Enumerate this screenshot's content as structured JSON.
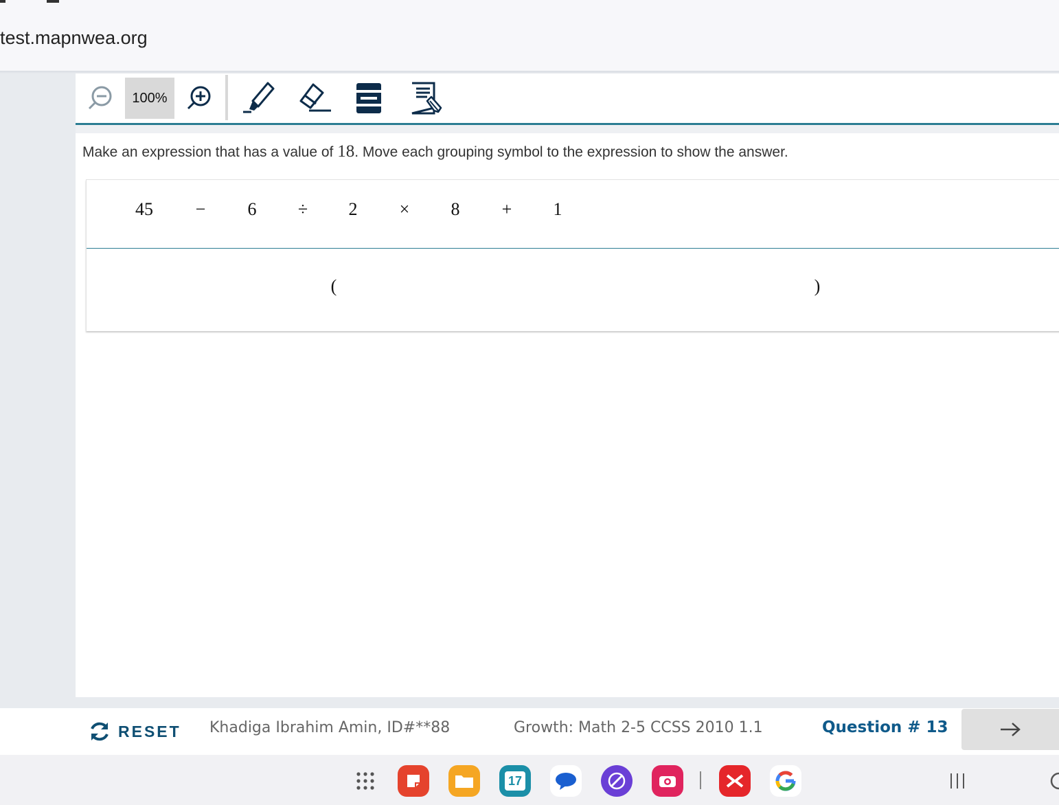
{
  "browser": {
    "url": "test.mapnwea.org"
  },
  "toolbar": {
    "zoom_level": "100%",
    "tools": [
      "zoom-out",
      "zoom-in",
      "highlighter",
      "eraser",
      "line-reader",
      "notepad"
    ]
  },
  "question": {
    "prompt_before": "Make an expression that has a value of ",
    "target_value": "18",
    "prompt_after": ". Move each grouping symbol to the expression to show the answer.",
    "expression": [
      "45",
      "−",
      "6",
      "÷",
      "2",
      "×",
      "8",
      "+",
      "1"
    ],
    "grouping_symbols": [
      "(",
      ")"
    ]
  },
  "footer": {
    "reset_label": "RESET",
    "student": "Khadiga Ibrahim Amin, ID#**88",
    "test_name": "Growth: Math 2-5 CCSS 2010 1.1",
    "question_number": "Question # 13"
  },
  "taskbar": {
    "calendar_day": "17",
    "apps": [
      "app-drawer",
      "notes",
      "files",
      "calendar",
      "messages",
      "notes-pen",
      "camera",
      "x-app",
      "google"
    ]
  },
  "colors": {
    "accent": "#2b7d93",
    "brand_dark": "#0f4f73",
    "question_num": "#0f5a8a"
  }
}
